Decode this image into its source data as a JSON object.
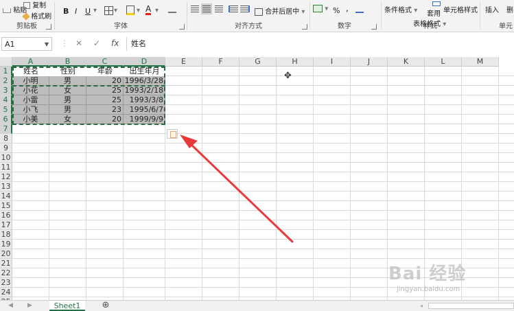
{
  "ribbon": {
    "clipboard": {
      "paste": "粘贴",
      "copy": "复制",
      "format_painter": "格式刷",
      "label": "剪贴板"
    },
    "font": {
      "bold": "B",
      "italic": "I",
      "underline": "U",
      "font_color_letter": "A",
      "label": "字体"
    },
    "alignment": {
      "merge_center": "合并后居中",
      "label": "对齐方式"
    },
    "number": {
      "percent": "%",
      "comma": ",",
      "label": "数字"
    },
    "styles": {
      "conditional": "条件格式",
      "table_format_1": "套用",
      "table_format_2": "表格格式",
      "cell_styles": "单元格样式",
      "label": "样式"
    },
    "cells": {
      "insert": "插入",
      "delete": "删",
      "label": "单元"
    }
  },
  "formula_bar": {
    "name_box": "A1",
    "cancel": "✕",
    "enter": "✓",
    "fx": "fx",
    "content": "姓名"
  },
  "columns": [
    "A",
    "B",
    "C",
    "D",
    "E",
    "F",
    "G",
    "H",
    "I",
    "J",
    "K",
    "L",
    "M"
  ],
  "selected_columns": [
    "A",
    "B",
    "C",
    "D"
  ],
  "rows": [
    "1",
    "2",
    "3",
    "4",
    "5",
    "6",
    "7",
    "8",
    "9",
    "10",
    "11",
    "12",
    "13",
    "14",
    "15",
    "16",
    "17",
    "18",
    "19",
    "20",
    "21",
    "22",
    "23",
    "24",
    "25"
  ],
  "selected_rows": [
    "1",
    "2",
    "3",
    "4",
    "5",
    "6",
    "7"
  ],
  "table": {
    "headers": [
      "姓名",
      "性别",
      "年龄",
      "出生年月"
    ],
    "data": [
      [
        "小明",
        "男",
        "20",
        "1996/3/28"
      ],
      [
        "小花",
        "女",
        "25",
        "1993/2/18"
      ],
      [
        "小雷",
        "男",
        "25",
        "1993/3/8"
      ],
      [
        "小飞",
        "男",
        "23",
        "1995/6/7"
      ],
      [
        "小美",
        "女",
        "20",
        "1999/9/9"
      ]
    ]
  },
  "sheets": {
    "tabs": [
      "Sheet1"
    ],
    "active": "Sheet1",
    "add": "⊕"
  },
  "watermark": {
    "text": "Bai 经验",
    "url": "jingyan.baidu.com"
  },
  "colors": {
    "accent": "#217346",
    "arrow": "#e83a3a",
    "selection_fill": "#bcbcbc"
  }
}
